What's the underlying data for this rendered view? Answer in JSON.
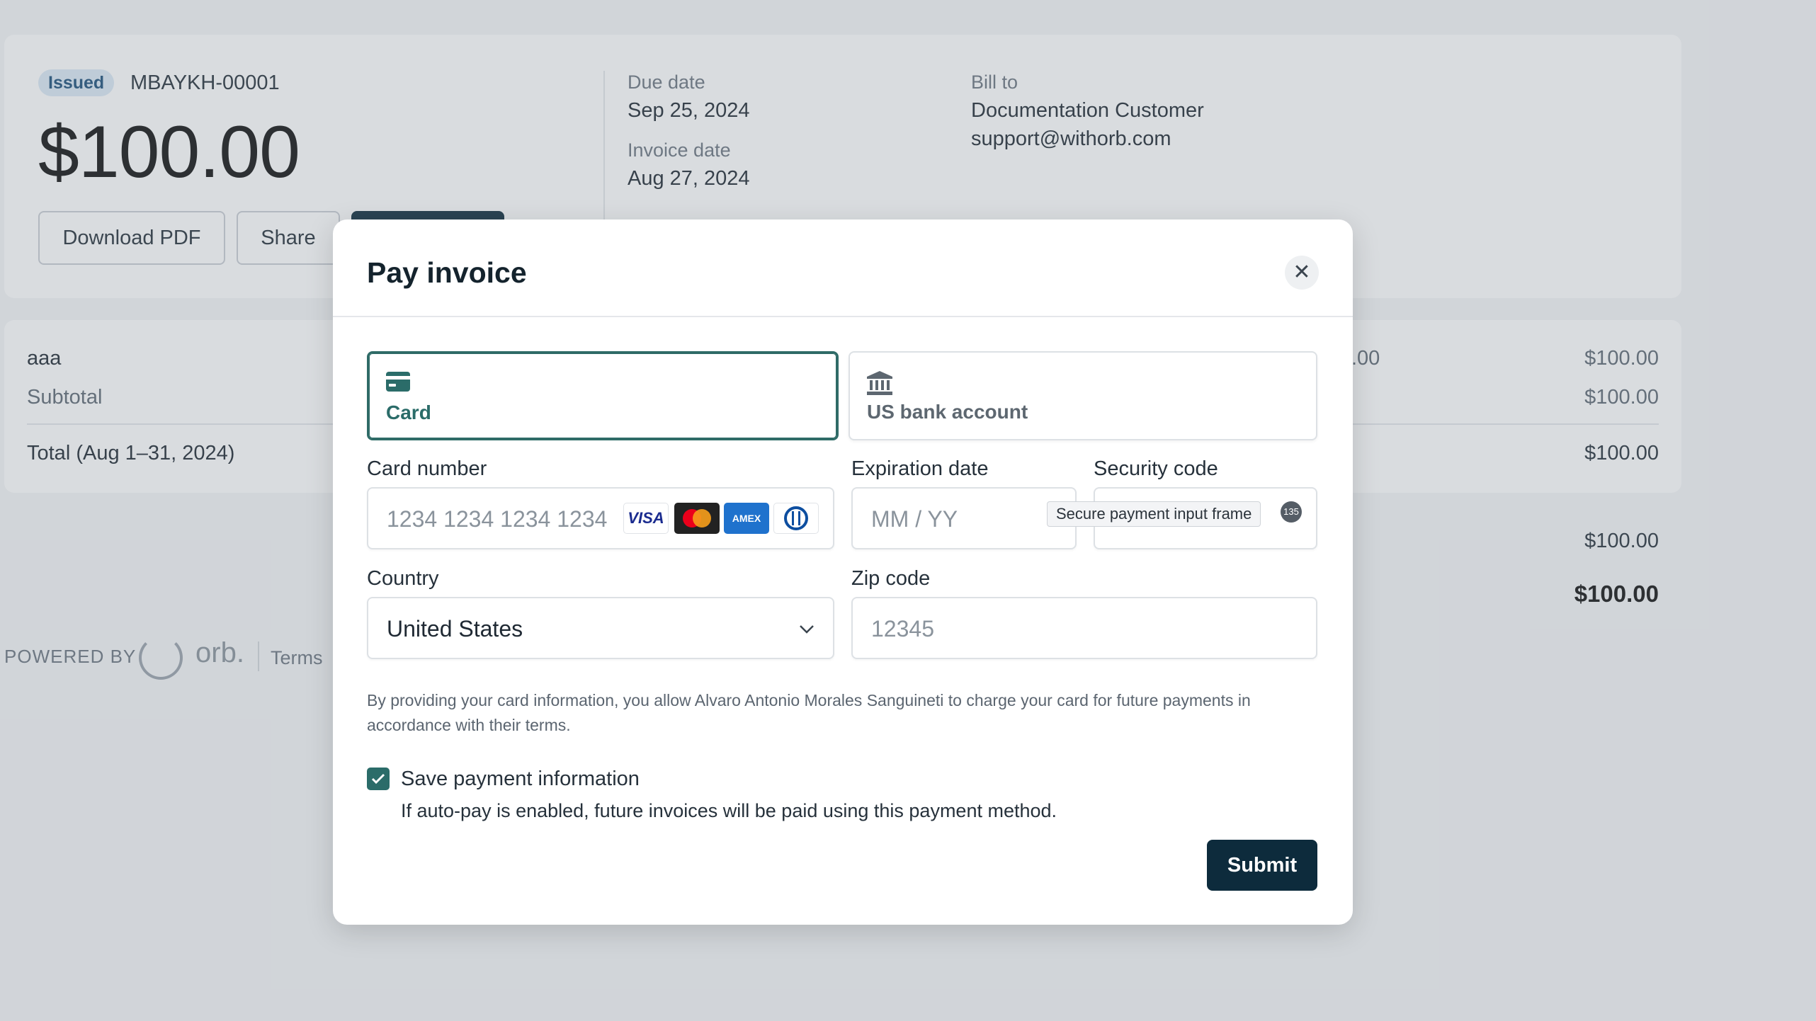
{
  "invoice": {
    "status": "Issued",
    "number": "MBAYKH-00001",
    "amount": "$100.00",
    "download_label": "Download PDF",
    "share_label": "Share",
    "due_date_label": "Due date",
    "due_date": "Sep 25, 2024",
    "invoice_date_label": "Invoice date",
    "invoice_date": "Aug 27, 2024",
    "bill_to_label": "Bill to",
    "customer_name": "Documentation Customer",
    "customer_email": "support@withorb.com"
  },
  "line_items": {
    "item_name": "aaa",
    "item_partial_value": ".00",
    "item_amount": "$100.00",
    "subtotal_label": "Subtotal",
    "subtotal": "$100.00",
    "total_label": "Total (Aug 1–31, 2024)",
    "total": "$100.00",
    "summary_value": "$100.00",
    "summary_total": "$100.00"
  },
  "footer": {
    "powered_by": "POWERED BY",
    "brand": "orb.",
    "terms": "Terms"
  },
  "modal": {
    "title": "Pay invoice",
    "close_glyph": "✕",
    "tabs": [
      {
        "label": "Card",
        "icon": "credit-card-icon",
        "selected": true
      },
      {
        "label": "US bank account",
        "icon": "bank-icon",
        "selected": false
      }
    ],
    "card_number_label": "Card number",
    "card_number_placeholder": "1234 1234 1234 1234",
    "brands": [
      "VISA",
      "Mastercard",
      "AMEX",
      "Diners Club"
    ],
    "expiration_label": "Expiration date",
    "expiration_placeholder": "MM / YY",
    "security_label": "Security code",
    "tooltip": "Secure payment input frame",
    "tooltip_badge": "135",
    "country_label": "Country",
    "country_value": "United States",
    "zip_label": "Zip code",
    "zip_placeholder": "12345",
    "disclaimer": "By providing your card information, you allow Alvaro Antonio Morales Sanguineti to charge your card for future payments in accordance with their terms.",
    "save_label": "Save payment information",
    "save_checked": true,
    "save_help": "If auto-pay is enabled, future invoices will be paid using this payment method.",
    "submit_label": "Submit"
  },
  "colors": {
    "accent": "#2b6c69",
    "primary_button": "#0d2b3c",
    "badge_bg": "#dbe9f6"
  }
}
